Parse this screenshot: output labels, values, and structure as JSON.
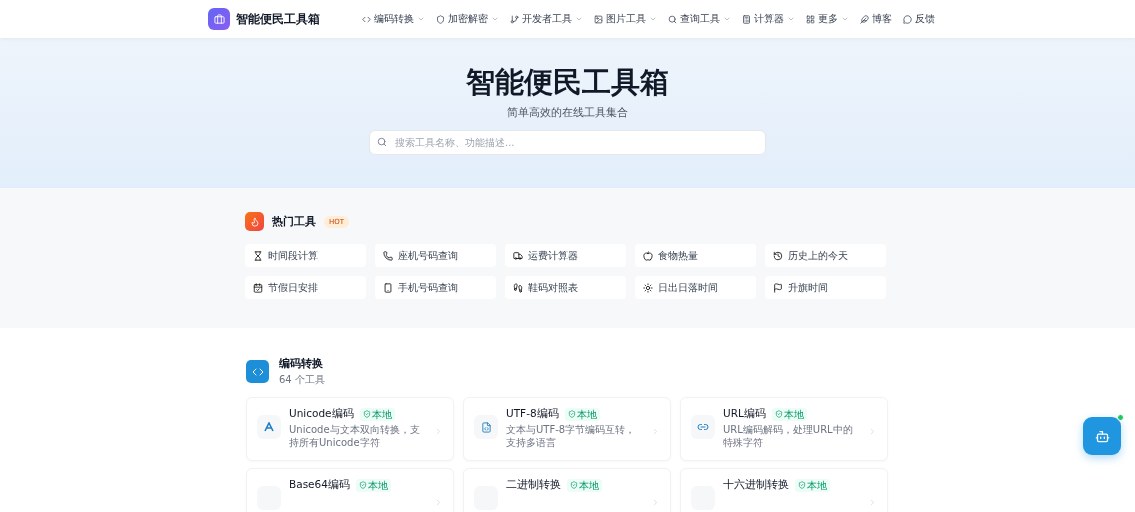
{
  "brand": {
    "name": "智能便民工具箱"
  },
  "nav": [
    {
      "label": "编码转换",
      "dropdown": true
    },
    {
      "label": "加密解密",
      "dropdown": true
    },
    {
      "label": "开发者工具",
      "dropdown": true
    },
    {
      "label": "图片工具",
      "dropdown": true
    },
    {
      "label": "查询工具",
      "dropdown": true
    },
    {
      "label": "计算器",
      "dropdown": true
    },
    {
      "label": "更多",
      "dropdown": true
    },
    {
      "label": "博客",
      "dropdown": false
    },
    {
      "label": "反馈",
      "dropdown": false
    }
  ],
  "hero": {
    "title": "智能便民工具箱",
    "subtitle": "简单高效的在线工具集合",
    "search": {
      "placeholder": "搜索工具名称、功能描述..."
    }
  },
  "hot": {
    "title": "热门工具",
    "badge": "HOT",
    "tools": [
      {
        "label": "时间段计算"
      },
      {
        "label": "座机号码查询"
      },
      {
        "label": "运费计算器"
      },
      {
        "label": "食物热量"
      },
      {
        "label": "历史上的今天"
      },
      {
        "label": "节假日安排"
      },
      {
        "label": "手机号码查询"
      },
      {
        "label": "鞋码对照表"
      },
      {
        "label": "日出日落时间"
      },
      {
        "label": "升旗时间"
      }
    ]
  },
  "category": {
    "title": "编码转换",
    "count": "64 个工具",
    "tools": [
      {
        "title": "Unicode编码",
        "badge": "本地",
        "description": "Unicode与文本双向转换，支持所有Unicode字符"
      },
      {
        "title": "UTF-8编码",
        "badge": "本地",
        "description": "文本与UTF-8字节编码互转，支持多语言"
      },
      {
        "title": "URL编码",
        "badge": "本地",
        "description": "URL编码解码，处理URL中的特殊字符"
      },
      {
        "title": "Base64编码",
        "badge": "本地"
      },
      {
        "title": "二进制转换",
        "badge": "本地"
      },
      {
        "title": "十六进制转换",
        "badge": "本地"
      }
    ]
  },
  "assistant": {
    "online": true
  }
}
